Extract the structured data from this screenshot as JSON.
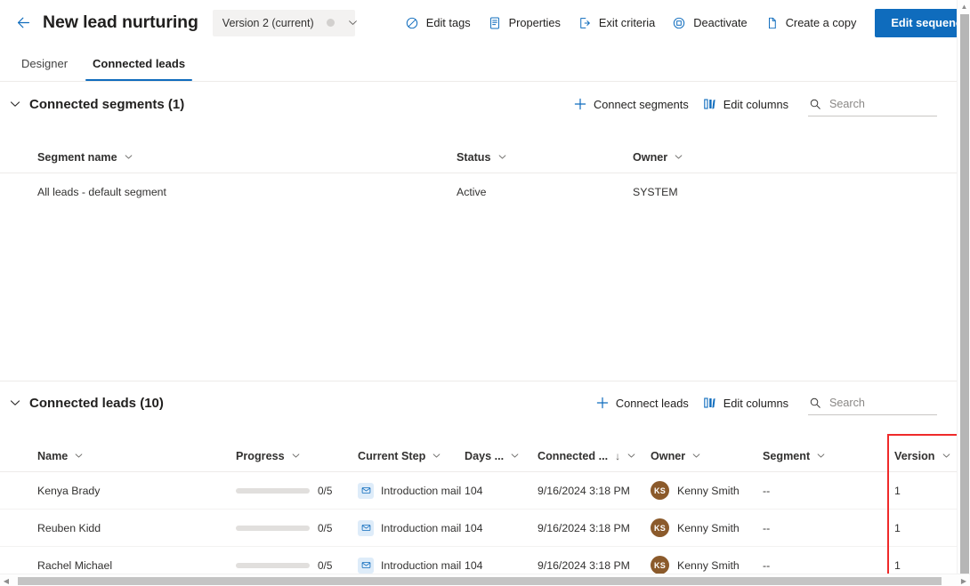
{
  "header": {
    "back_icon": "arrow-left-icon",
    "title": "New lead nurturing",
    "version_selector": {
      "label": "Version 2 (current)",
      "chevron_icon": "chevron-down-icon"
    },
    "commands": [
      {
        "icon": "tag-icon",
        "label": "Edit tags"
      },
      {
        "icon": "document-icon",
        "label": "Properties"
      },
      {
        "icon": "exit-icon",
        "label": "Exit criteria"
      },
      {
        "icon": "stop-icon",
        "label": "Deactivate"
      },
      {
        "icon": "copy-icon",
        "label": "Create a copy"
      }
    ],
    "primary_button": "Edit sequence",
    "accent_color": "#0f6cbd"
  },
  "tabs": [
    {
      "label": "Designer",
      "active": false
    },
    {
      "label": "Connected leads",
      "active": true
    }
  ],
  "segments_section": {
    "chevron_icon": "chevron-down-icon",
    "title": "Connected segments (1)",
    "actions": [
      {
        "icon": "plus-icon",
        "label": "Connect segments"
      },
      {
        "icon": "columns-icon",
        "label": "Edit columns"
      }
    ],
    "search": {
      "icon": "search-icon",
      "placeholder": "Search",
      "value": ""
    },
    "columns": [
      {
        "label": "Segment name",
        "sort": ""
      },
      {
        "label": "Status",
        "sort": ""
      },
      {
        "label": "Owner",
        "sort": ""
      }
    ],
    "rows": [
      {
        "name": "All leads - default segment",
        "status": "Active",
        "owner": "SYSTEM"
      }
    ]
  },
  "leads_section": {
    "chevron_icon": "chevron-down-icon",
    "title": "Connected leads (10)",
    "actions": [
      {
        "icon": "plus-icon",
        "label": "Connect leads"
      },
      {
        "icon": "columns-icon",
        "label": "Edit columns"
      }
    ],
    "search": {
      "icon": "search-icon",
      "placeholder": "Search",
      "value": ""
    },
    "columns": [
      {
        "label": "Name",
        "sort": ""
      },
      {
        "label": "Progress",
        "sort": ""
      },
      {
        "label": "Current Step",
        "sort": ""
      },
      {
        "label": "Days ...",
        "sort": ""
      },
      {
        "label": "Connected ...",
        "sort": "↓"
      },
      {
        "label": "Owner",
        "sort": ""
      },
      {
        "label": "Segment",
        "sort": ""
      },
      {
        "label": "Version",
        "sort": ""
      }
    ],
    "rows": [
      {
        "name": "Kenya Brady",
        "progress_text": "0/5",
        "progress_pct": 0,
        "step_icon": "mail-icon",
        "step": "Introduction mail",
        "days": "104",
        "connected": "9/16/2024 3:18 PM",
        "owner_initials": "KS",
        "owner": "Kenny Smith",
        "segment": "--",
        "version": "1"
      },
      {
        "name": "Reuben Kidd",
        "progress_text": "0/5",
        "progress_pct": 0,
        "step_icon": "mail-icon",
        "step": "Introduction mail",
        "days": "104",
        "connected": "9/16/2024 3:18 PM",
        "owner_initials": "KS",
        "owner": "Kenny Smith",
        "segment": "--",
        "version": "1"
      },
      {
        "name": "Rachel Michael",
        "progress_text": "0/5",
        "progress_pct": 0,
        "step_icon": "mail-icon",
        "step": "Introduction mail",
        "days": "104",
        "connected": "9/16/2024 3:18 PM",
        "owner_initials": "KS",
        "owner": "Kenny Smith",
        "segment": "--",
        "version": "1"
      }
    ],
    "avatar_color": "#8b5a2b"
  },
  "highlight": {
    "color": "#ef2a2a",
    "target": "version-column"
  },
  "scrollbars": {
    "vertical_up_arrow": "▲",
    "horizontal_left_arrow": "◀",
    "horizontal_right_arrow": "▶"
  }
}
